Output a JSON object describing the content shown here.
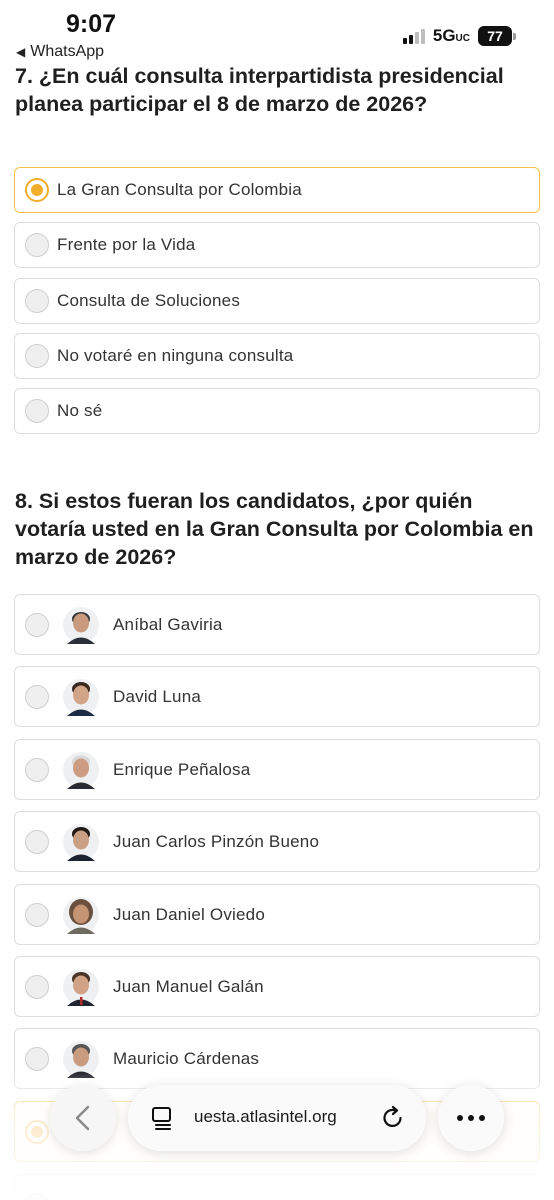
{
  "status_bar": {
    "time": "9:07",
    "back_app": "WhatsApp",
    "network": "5G",
    "network_suffix": "UC",
    "battery": "77",
    "signal_bars_on": 2
  },
  "q7": {
    "title": "7. ¿En cuál consulta interpartidista presidencial planea participar el 8 de marzo de 2026?",
    "options": [
      {
        "label": "La Gran Consulta por Colombia",
        "selected": true
      },
      {
        "label": "Frente por la Vida",
        "selected": false
      },
      {
        "label": "Consulta de Soluciones",
        "selected": false
      },
      {
        "label": "No votaré en ninguna consulta",
        "selected": false
      },
      {
        "label": "No sé",
        "selected": false
      }
    ]
  },
  "q8": {
    "title": "8. Si estos fueran los candidatos, ¿por quién votaría usted en la Gran Consulta por Colombia en marzo de 2026?",
    "options": [
      {
        "label": "Aníbal Gaviria",
        "selected": false
      },
      {
        "label": "David Luna",
        "selected": false
      },
      {
        "label": "Enrique Peñalosa",
        "selected": false
      },
      {
        "label": "Juan Carlos Pinzón Bueno",
        "selected": false
      },
      {
        "label": "Juan Daniel Oviedo",
        "selected": false
      },
      {
        "label": "Juan Manuel Galán",
        "selected": false
      },
      {
        "label": "Mauricio Cárdenas",
        "selected": false
      }
    ]
  },
  "browser_bar": {
    "url": "uesta.atlasintel.org",
    "back_icon": "chevron-left-icon",
    "tabs_icon": "tabs-icon",
    "reload_icon": "reload-icon",
    "more_icon": "more-icon"
  },
  "colors": {
    "accent": "#f2ad2b",
    "selected_border": "#f3c24a",
    "option_border": "#dedede"
  }
}
